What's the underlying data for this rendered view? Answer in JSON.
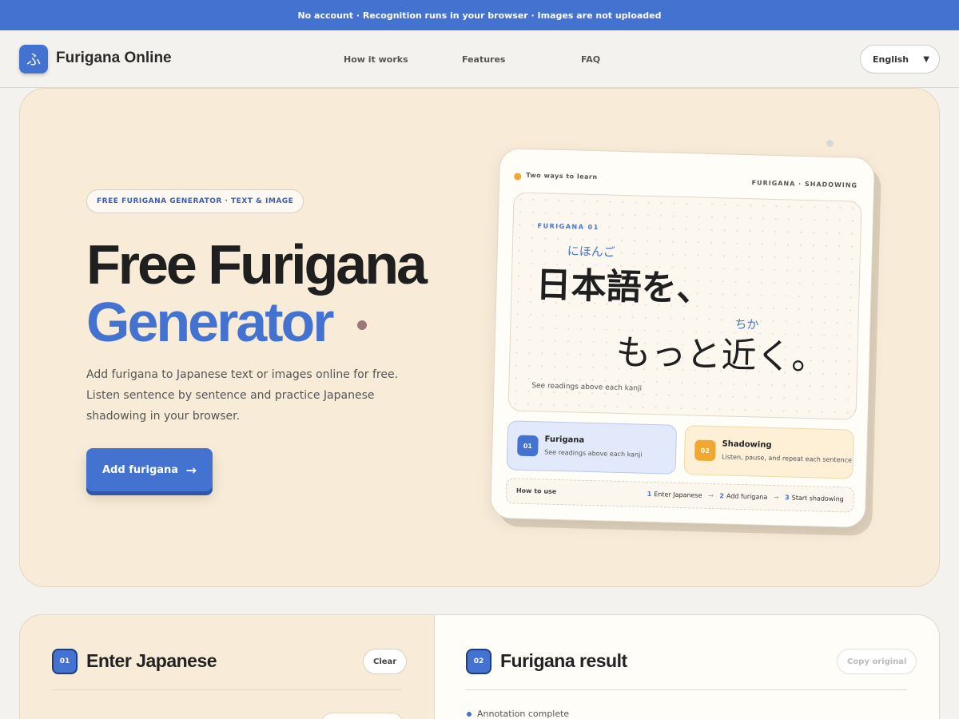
{
  "banner": {
    "text": "No account · Recognition runs in your browser · Images are not uploaded"
  },
  "nav": {
    "logo_glyph": "ふ",
    "brand": "Furigana Online",
    "links": [
      "How it works",
      "Features",
      "FAQ"
    ],
    "language": "English"
  },
  "hero": {
    "badge": "FREE FURIGANA GENERATOR · TEXT & IMAGE",
    "title_line1": "Free Furigana",
    "title_line2": "Generator",
    "description": "Add furigana to Japanese text or images online for free. Listen sentence by sentence and practice Japanese shadowing in your browser.",
    "cta_label": "Add furigana",
    "cta_arrow": "→"
  },
  "demo_card": {
    "top_label": "Two ways to learn",
    "top_right": "FURIGANA · SHADOWING",
    "panel_label": "FURIGANA 01",
    "ruby_1": "にほんご",
    "line_1": "日本語を、",
    "ruby_2": "ちか",
    "line_2": "もっと近く。",
    "panel_footer": "See readings above each kanji",
    "modes": [
      {
        "num": "01",
        "title": "Furigana",
        "sub": "See readings above each kanji"
      },
      {
        "num": "02",
        "title": "Shadowing",
        "sub": "Listen, pause, and repeat each sentence"
      }
    ],
    "how_to_label": "How to use",
    "steps": [
      {
        "n": "1",
        "label": "Enter Japanese"
      },
      {
        "n": "2",
        "label": "Add furigana"
      },
      {
        "n": "3",
        "label": "Start shadowing"
      }
    ],
    "step_arrow": "→"
  },
  "input_section": {
    "num": "01",
    "title": "Enter Japanese",
    "clear_label": "Clear"
  },
  "result_section": {
    "num": "02",
    "title": "Furigana result",
    "copy_label": "Copy original",
    "status": "Annotation complete"
  },
  "colors": {
    "accent": "#4472d0",
    "hero_bg": "#f8ecd8",
    "shadowing": "#f0a830"
  }
}
